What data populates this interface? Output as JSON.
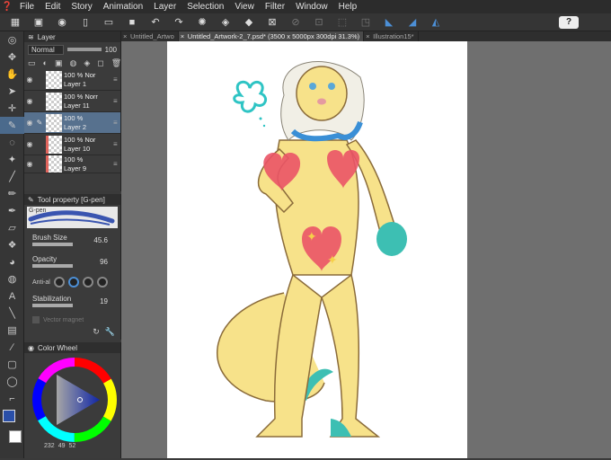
{
  "menubar": {
    "items": [
      "File",
      "Edit",
      "Story",
      "Animation",
      "Layer",
      "Selection",
      "View",
      "Filter",
      "Window",
      "Help"
    ]
  },
  "tabs": [
    {
      "label": "Untitled_Artwo",
      "active": false
    },
    {
      "label": "Untitled_Artwork-2_7.psd* (3500 x 5000px 300dpi 31.3%)",
      "active": true
    },
    {
      "label": "Illustration15*",
      "active": false
    }
  ],
  "layer_panel": {
    "title": "Layer",
    "blend_mode": "Normal",
    "opacity": "100",
    "layers": [
      {
        "line1": "100 % Nor",
        "line2": "Layer 1",
        "selected": false,
        "red": false
      },
      {
        "line1": "100 % Norr",
        "line2": "Layer 11",
        "selected": false,
        "red": false
      },
      {
        "line1": "100 %",
        "line2": "Layer 2",
        "selected": true,
        "red": false
      },
      {
        "line1": "100 % Nor",
        "line2": "Layer 10",
        "selected": false,
        "red": true
      },
      {
        "line1": "100 %",
        "line2": "Layer 9",
        "selected": false,
        "red": true
      }
    ]
  },
  "tool_property": {
    "title": "Tool property [G-pen]",
    "brush_name": "G-pen",
    "brush_size_label": "Brush Size",
    "brush_size": "45.6",
    "opacity_label": "Opacity",
    "opacity": "96",
    "antialias_label": "Anti-al",
    "stabilization_label": "Stabilization",
    "stabilization": "19",
    "vector_label": "Vector magnet"
  },
  "color_wheel": {
    "title": "Color Wheel",
    "h": "232",
    "s": "49",
    "v": "52",
    "main_color": "#2a4fa8"
  }
}
